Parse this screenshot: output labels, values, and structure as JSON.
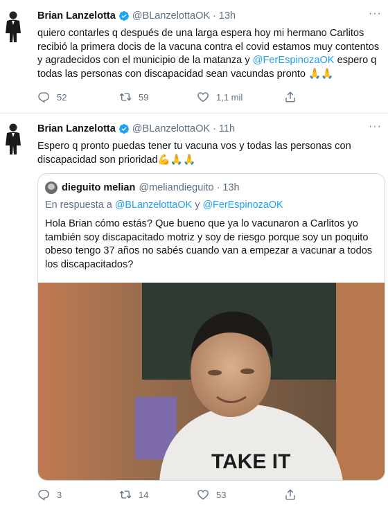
{
  "tweet1": {
    "name": "Brian Lanzelotta",
    "handle": "@BLanzelottaOK",
    "separator": "·",
    "time": "13h",
    "text_part1": "quiero contarles q después de una larga espera hoy mi hermano Carlitos recibió la primera docis de la vacuna contra el covid estamos muy contentos y agradecidos con el municipio de la matanza  y ",
    "mention": "@FerEspinozaOK",
    "text_part2": " espero q todas las personas con discapacidad sean vacundas pronto ",
    "emoji": "🙏🙏",
    "reply_count": "52",
    "retweet_count": "59",
    "like_count": "1,1 mil"
  },
  "tweet2": {
    "name": "Brian Lanzelotta",
    "handle": "@BLanzelottaOK",
    "separator": "·",
    "time": "11h",
    "text": "Espero q pronto puedas tener tu vacuna vos y todas las personas con discapacidad son prioridad",
    "emoji": "💪🙏🙏",
    "reply_count": "3",
    "retweet_count": "14",
    "like_count": "53"
  },
  "quoted": {
    "name": "dieguito melian",
    "handle": "@meliandieguito",
    "separator": "·",
    "time": "13h",
    "reply_prefix": "En respuesta a ",
    "reply_mention1": "@BLanzelottaOK",
    "reply_joiner": " y ",
    "reply_mention2": "@FerEspinozaOK",
    "text": "Hola Brian cómo estás? Que bueno que ya lo vacunaron a Carlitos yo también soy discapacitado motriz y soy de riesgo porque soy un poquito obeso tengo 37 años no sabés cuando van a empezar a vacunar a todos los discapacitados?",
    "photo_shirt_text": "TAKE IT"
  },
  "colors": {
    "accent": "#1da1f2",
    "secondary_text": "#5b7083",
    "border": "#cfd9de"
  },
  "icons": {
    "verified": "verified-badge-icon",
    "reply": "reply-icon",
    "retweet": "retweet-icon",
    "like": "heart-icon",
    "share": "share-icon",
    "more": "more-dots-icon"
  }
}
